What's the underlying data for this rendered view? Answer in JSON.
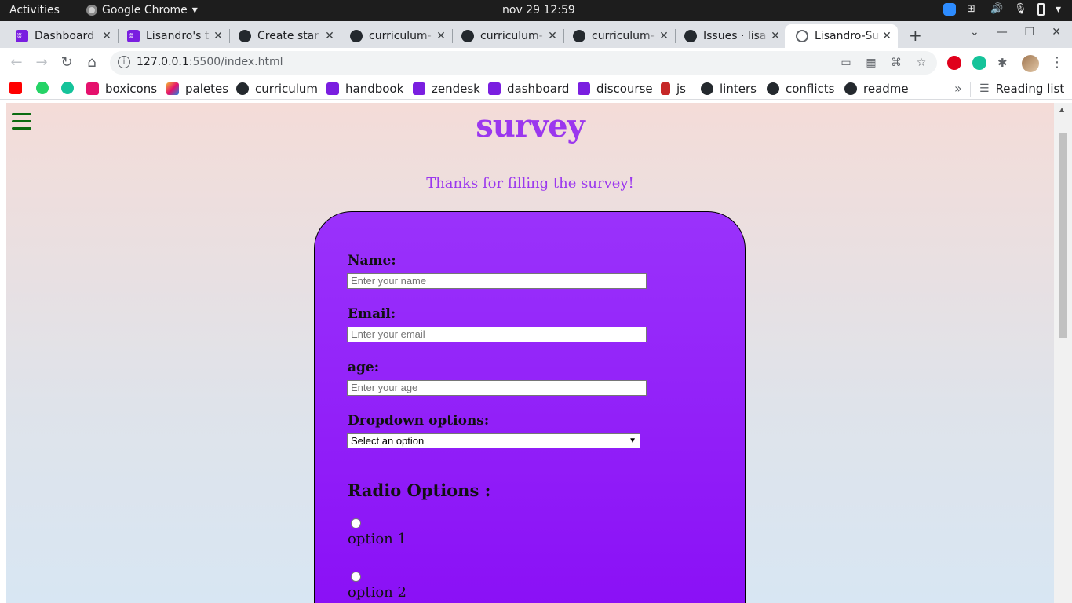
{
  "system": {
    "activities": "Activities",
    "app_name": "Google Chrome",
    "clock": "nov 29  12:59"
  },
  "tabs": [
    {
      "label": "Dashboard",
      "icon": "microverse-icon"
    },
    {
      "label": "Lisandro's t",
      "icon": "microverse-icon"
    },
    {
      "label": "Create star",
      "icon": "github-icon"
    },
    {
      "label": "curriculum-",
      "icon": "github-icon"
    },
    {
      "label": "curriculum-",
      "icon": "github-icon"
    },
    {
      "label": "curriculum-",
      "icon": "github-icon"
    },
    {
      "label": "Issues · lisa",
      "icon": "github-icon"
    },
    {
      "label": "Lisandro-Su",
      "icon": "globe-icon",
      "active": true
    }
  ],
  "toolbar": {
    "url_host": "127.0.0.1",
    "url_path": ":5500/index.html"
  },
  "bookmarks": [
    {
      "label": "",
      "icon": "youtube-icon",
      "color": "#ff0000"
    },
    {
      "label": "",
      "icon": "whatsapp-icon",
      "color": "#25d366"
    },
    {
      "label": "",
      "icon": "grammarly-icon",
      "color": "#15c39a"
    },
    {
      "label": "boxicons",
      "icon": "boxicons-icon",
      "color": "#e5116d"
    },
    {
      "label": "paletes",
      "icon": "paletes-icon",
      "color": "#f2b632"
    },
    {
      "label": "curriculum",
      "icon": "github-icon",
      "color": "#24292e"
    },
    {
      "label": "handbook",
      "icon": "microverse-icon",
      "color": "#7a1ee0"
    },
    {
      "label": "zendesk",
      "icon": "microverse-icon",
      "color": "#7a1ee0"
    },
    {
      "label": "dashboard",
      "icon": "microverse-icon",
      "color": "#7a1ee0"
    },
    {
      "label": "discourse",
      "icon": "microverse-icon",
      "color": "#7a1ee0"
    },
    {
      "label": "js",
      "icon": "js-icon",
      "color": "#c62828"
    },
    {
      "label": "linters",
      "icon": "github-icon",
      "color": "#24292e"
    },
    {
      "label": "conflicts",
      "icon": "github-icon",
      "color": "#24292e"
    },
    {
      "label": "readme",
      "icon": "github-icon",
      "color": "#24292e"
    }
  ],
  "reading_list": "Reading list",
  "page": {
    "title": "survey",
    "thanks": "Thanks for filling the survey!",
    "fields": [
      {
        "label": "Name:",
        "placeholder": "Enter your name"
      },
      {
        "label": "Email:",
        "placeholder": "Enter your email"
      },
      {
        "label": "age:",
        "placeholder": "Enter your age"
      }
    ],
    "dropdown": {
      "label": "Dropdown options:",
      "selected": "Select an option"
    },
    "radio": {
      "title": "Radio Options :",
      "options": [
        "option 1",
        "option 2"
      ]
    }
  },
  "colors": {
    "accent": "#9b37ee",
    "card_top": "#9a32fb",
    "card_bottom": "#8a0ff6",
    "hamburger": "#0b6b11"
  }
}
